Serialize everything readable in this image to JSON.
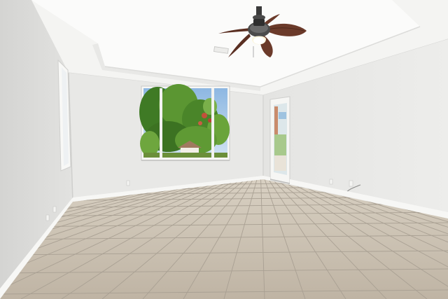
{
  "scene": {
    "description_kind": "photo",
    "colors": {
      "ceiling": "#f6f6f4",
      "tray_ceiling": "#fbfbfa",
      "back_wall": "#e9e9e7",
      "left_wall": "#dcdcda",
      "right_wall": "#e6e6e4",
      "floor": "#cdc3b4",
      "grout": "#a9a093",
      "baseboard": "#f7f7f5",
      "foliage": "#4f8a2c",
      "sky": "#9ec3e6",
      "fan_blade": "#6b3a2a"
    }
  }
}
